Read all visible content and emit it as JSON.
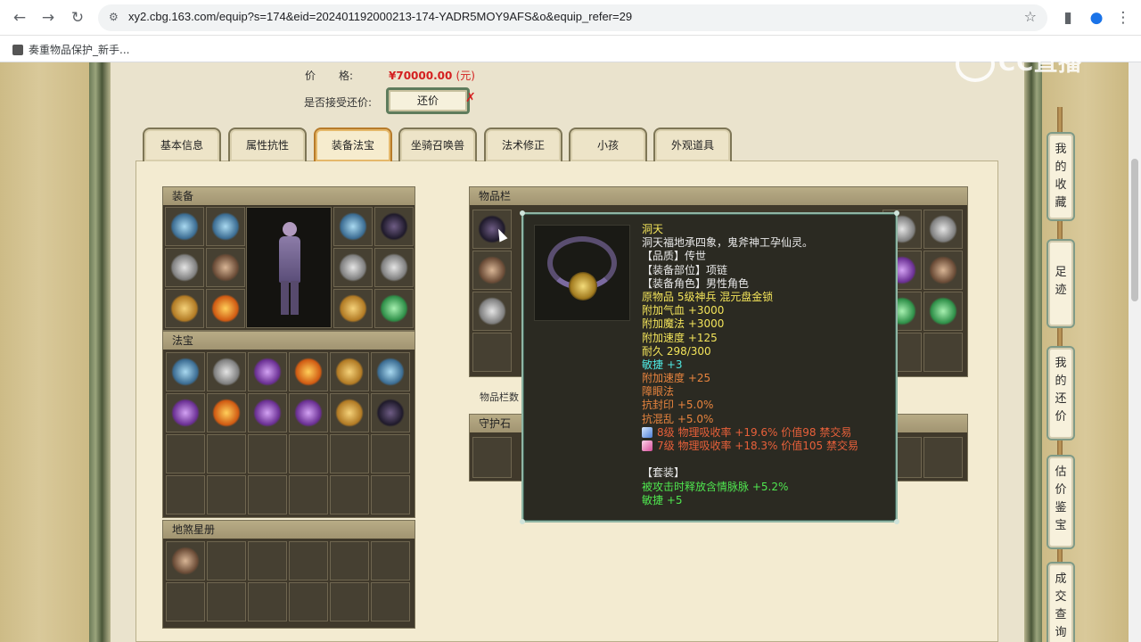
{
  "browser": {
    "url": "xy2.cbg.163.com/equip?s=174&eid=202401192000213-174-YADR5MOY9AFS&o&equip_refer=29",
    "bookmark": "奏重物品保护_新手..."
  },
  "watermark": "CC直播",
  "price": {
    "label_a": "价",
    "label_b": "格:",
    "value": "¥70000.00",
    "unit": "(元)"
  },
  "counter_offer": {
    "label": "是否接受还价:",
    "button": "还价",
    "mark": "✗"
  },
  "tabs": [
    "基本信息",
    "属性抗性",
    "装备法宝",
    "坐骑召唤兽",
    "法术修正",
    "小孩",
    "外观道具"
  ],
  "active_tab": "装备法宝",
  "panels": {
    "equipment": "装备",
    "fabao": "法宝",
    "star_book": "地煞星册",
    "inventory": "物品栏",
    "inventory_note": "物品栏数",
    "guard_stone": "守护石"
  },
  "tooltip": {
    "name": "洞天",
    "desc": "洞天福地承四象，鬼斧神工孕仙灵。",
    "quality": "【品质】传世",
    "slot": "【装备部位】项链",
    "role": "【装备角色】男性角色",
    "origin": "原物品 5级神兵 混元盘金锁",
    "stats": [
      "附加气血 +3000",
      "附加魔法 +3000",
      "附加速度 +125",
      "耐久 298/300"
    ],
    "agility": "敏捷 +3",
    "extra_speed": "附加速度 +25",
    "special": [
      "障眼法",
      "抗封印 +5.0%",
      "抗混乱 +5.0%"
    ],
    "gems": [
      {
        "text": "8级 物理吸收率 +19.6% 价值98 禁交易",
        "color": "#4d7fd6"
      },
      {
        "text": "7级 物理吸收率 +18.3% 价值105 禁交易",
        "color": "#d64d9a"
      }
    ],
    "set_title": "【套装】",
    "set_effects": [
      "被攻击时释放含情脉脉 +5.2%",
      "敏捷 +5"
    ]
  },
  "side_nav": [
    "我的收藏",
    "足迹",
    "我的还价",
    "估价鉴宝",
    "成交查询"
  ]
}
